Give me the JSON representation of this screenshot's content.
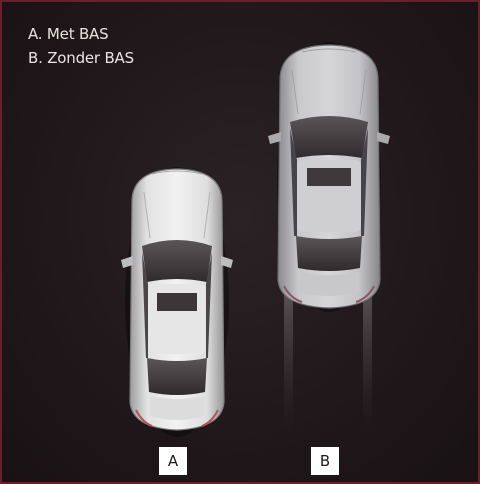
{
  "legend": {
    "item_a": "A. Met BAS",
    "item_b": "B. Zonder BAS"
  },
  "labels": {
    "a": "A",
    "b": "B"
  },
  "colors": {
    "border": "#6a1f2b",
    "background": "#1f1719",
    "car_body": "#d8d8d8",
    "label_bg": "#ffffff"
  }
}
